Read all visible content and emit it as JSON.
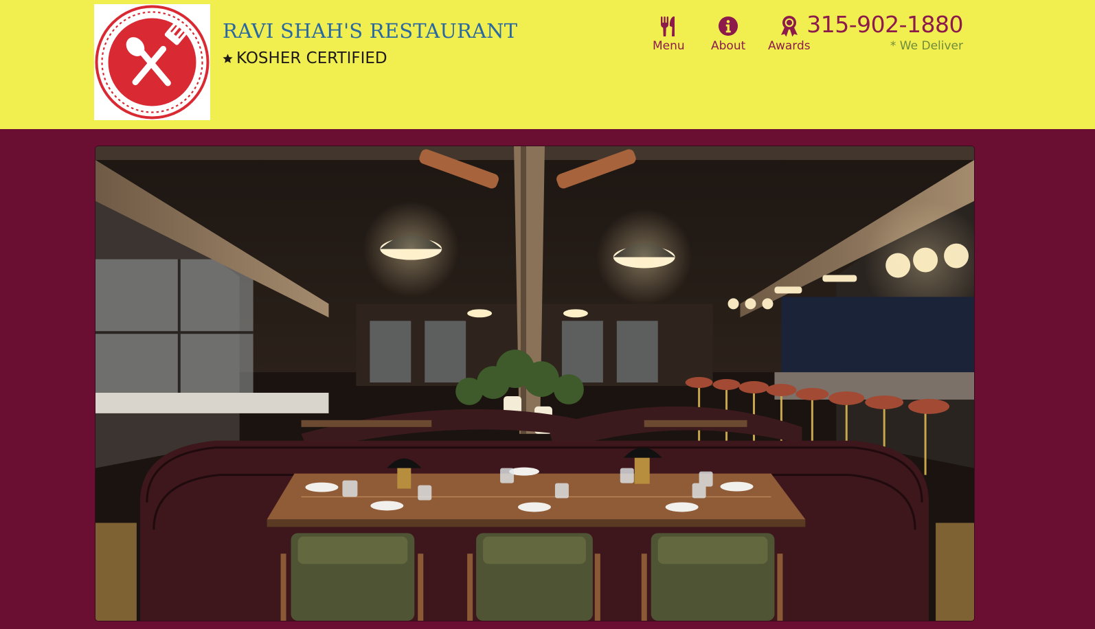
{
  "brand": {
    "name": "RAVI SHAH'S RESTAURANT",
    "certification": "KOSHER CERTIFIED",
    "logo_icon": "spoon-fork-crossed-icon"
  },
  "nav": {
    "menu": {
      "label": "Menu",
      "icon": "fork-knife-icon"
    },
    "about": {
      "label": "About",
      "icon": "info-circle-icon"
    },
    "awards": {
      "label": "Awards",
      "icon": "award-ribbon-icon"
    }
  },
  "contact": {
    "phone": "315-902-1880",
    "delivery_note": "* We Deliver"
  },
  "hero": {
    "alt": "restaurant interior photo"
  },
  "colors": {
    "header_bg": "#f1ee50",
    "page_bg": "#6b0f32",
    "accent": "#8c1b4c",
    "brand_blue": "#2a68a0",
    "logo_red": "#d92a34",
    "delivery_green": "#6e8a3a"
  }
}
